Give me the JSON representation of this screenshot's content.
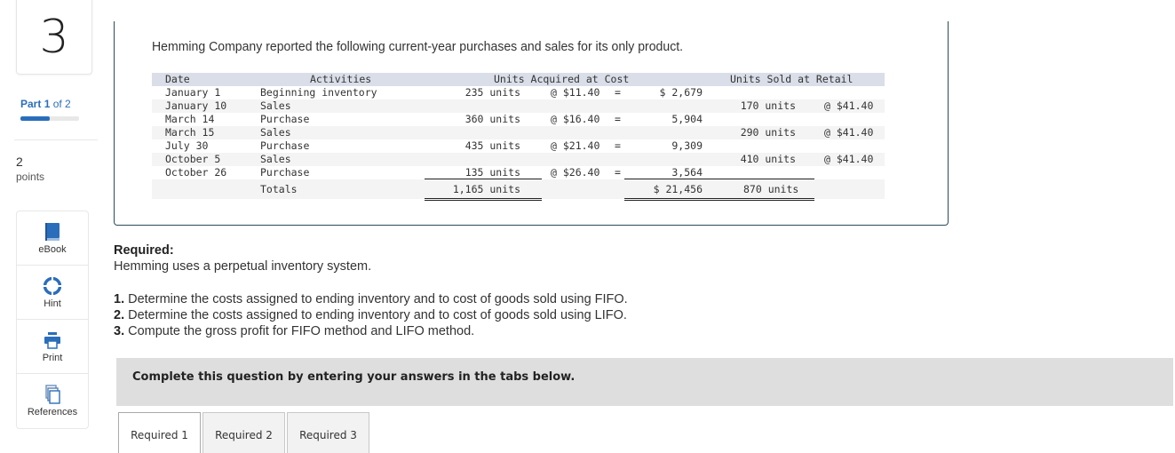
{
  "question": {
    "number": "3",
    "part_label": "Part",
    "part_current": "1",
    "part_of": "of 2",
    "part_progress": 0.5,
    "points_value": "2",
    "points_label": "points"
  },
  "tools": [
    {
      "label": "eBook",
      "icon": "book-icon"
    },
    {
      "label": "Hint",
      "icon": "lifebuoy-icon"
    },
    {
      "label": "Print",
      "icon": "printer-icon"
    },
    {
      "label": "References",
      "icon": "copy-documents-icon"
    }
  ],
  "colors": {
    "accent": "#2a6ebb",
    "box_border": "#2c4a5a",
    "table_header_bg": "#d9dee8",
    "banner_bg": "#dedede"
  },
  "problem": {
    "intro": "Hemming Company reported the following current-year purchases and sales for its only product.",
    "table": {
      "headers": {
        "date": "Date",
        "activities": "Activities",
        "acquired": "Units Acquired at Cost",
        "sold": "Units Sold at Retail"
      },
      "rows": [
        {
          "date": "January 1",
          "activity": "Beginning inventory",
          "units": "235 units",
          "cost": "@ $11.40",
          "eq": "=",
          "amount": "$ 2,679",
          "sold": "",
          "price": ""
        },
        {
          "date": "January 10",
          "activity": "Sales",
          "units": "",
          "cost": "",
          "eq": "",
          "amount": "",
          "sold": "170 units",
          "price": "@ $41.40"
        },
        {
          "date": "March 14",
          "activity": "Purchase",
          "units": "360 units",
          "cost": "@ $16.40",
          "eq": "=",
          "amount": "5,904",
          "sold": "",
          "price": ""
        },
        {
          "date": "March 15",
          "activity": "Sales",
          "units": "",
          "cost": "",
          "eq": "",
          "amount": "",
          "sold": "290 units",
          "price": "@ $41.40"
        },
        {
          "date": "July 30",
          "activity": "Purchase",
          "units": "435 units",
          "cost": "@ $21.40",
          "eq": "=",
          "amount": "9,309",
          "sold": "",
          "price": ""
        },
        {
          "date": "October 5",
          "activity": "Sales",
          "units": "",
          "cost": "",
          "eq": "",
          "amount": "",
          "sold": "410 units",
          "price": "@ $41.40"
        },
        {
          "date": "October 26",
          "activity": "Purchase",
          "units": "135 units",
          "cost": "@ $26.40",
          "eq": "=",
          "amount": "3,564",
          "sold": "",
          "price": ""
        }
      ],
      "totals": {
        "label": "Totals",
        "units": "1,165 units",
        "amount": "$ 21,456",
        "sold": "870 units"
      }
    }
  },
  "required": {
    "title": "Required:",
    "system": "Hemming uses a perpetual inventory system.",
    "items": [
      {
        "num": "1.",
        "text": " Determine the costs assigned to ending inventory and to cost of goods sold using FIFO."
      },
      {
        "num": "2.",
        "text": " Determine the costs assigned to ending inventory and to cost of goods sold using LIFO."
      },
      {
        "num": "3.",
        "text": " Compute the gross profit for FIFO method and LIFO method."
      }
    ]
  },
  "banner": "Complete this question by entering your answers in the tabs below.",
  "tabs": [
    {
      "label": "Required 1",
      "active": true
    },
    {
      "label": "Required 2",
      "active": false
    },
    {
      "label": "Required 3",
      "active": false
    }
  ]
}
